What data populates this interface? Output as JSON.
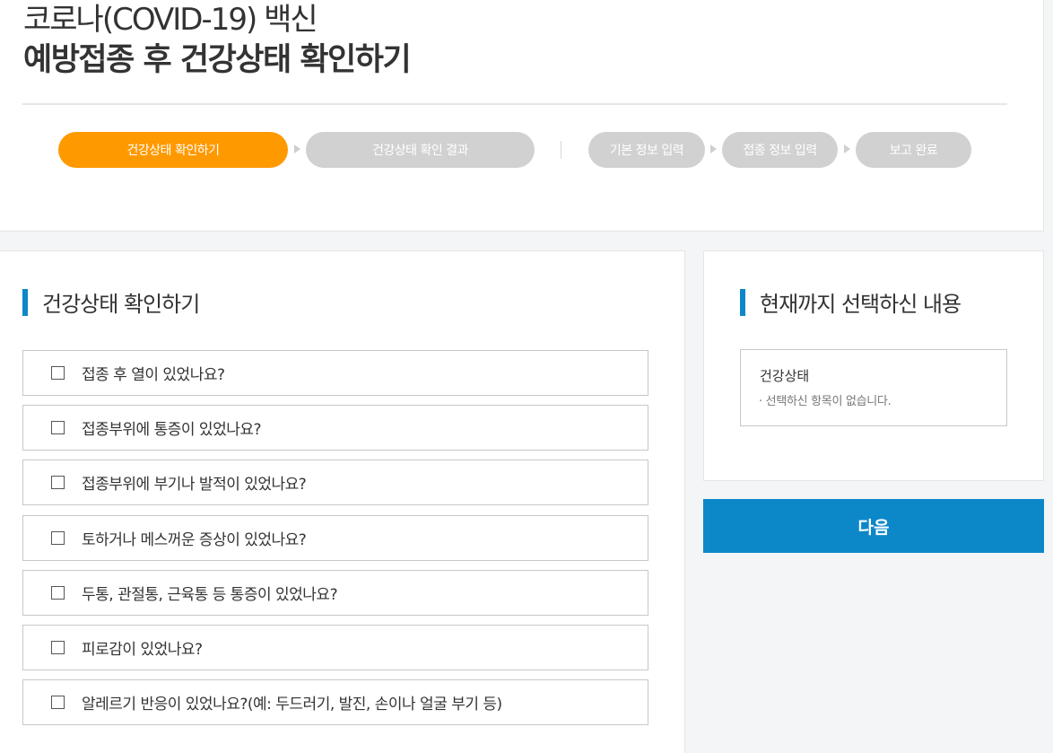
{
  "header": {
    "title_sub": "코로나(COVID-19) 백신",
    "title_main": "예방접종 후 건강상태 확인하기"
  },
  "steps": [
    {
      "label": "건강상태 확인하기",
      "active": true
    },
    {
      "label": "건강상태 확인 결과",
      "active": false
    },
    {
      "label": "기본 정보 입력",
      "active": false
    },
    {
      "label": "접종 정보 입력",
      "active": false
    },
    {
      "label": "보고 완료",
      "active": false
    }
  ],
  "check_section": {
    "title": "건강상태 확인하기",
    "questions": [
      "접종 후 열이 있었나요?",
      "접종부위에 통증이 있었나요?",
      "접종부위에 부기나 발적이 있었나요?",
      "토하거나 메스꺼운 증상이 있었나요?",
      "두통, 관절통, 근육통 등 통증이 있었나요?",
      "피로감이 있었나요?",
      "알레르기 반응이 있었나요?(예: 두드러기, 발진, 손이나 얼굴 부기 등)"
    ]
  },
  "summary": {
    "title": "현재까지 선택하신 내용",
    "heading": "건강상태",
    "empty_text": "· 선택하신 항목이 없습니다."
  },
  "next_button": "다음",
  "colors": {
    "accent_orange": "#ff9900",
    "accent_blue": "#0c88c9",
    "step_inactive": "#d1d1d1"
  }
}
